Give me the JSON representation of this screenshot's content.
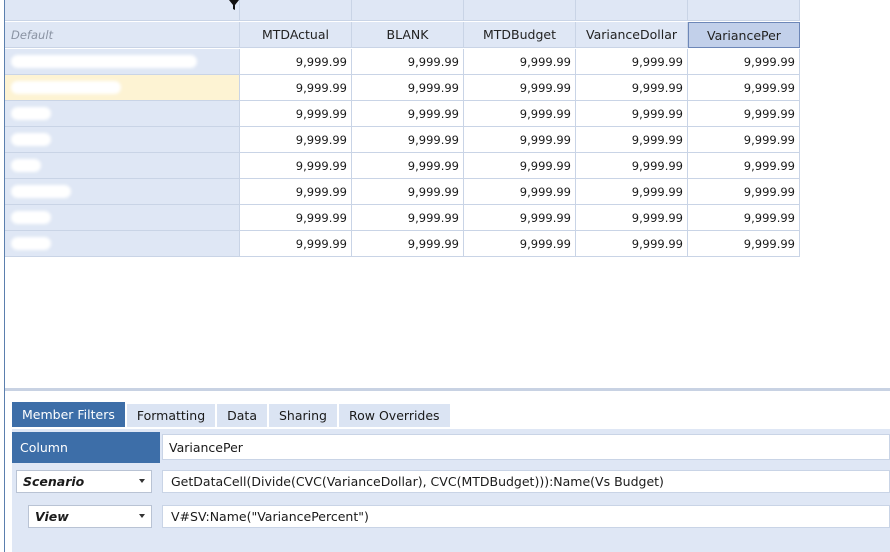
{
  "grid": {
    "row_header_label": "Default",
    "columns": [
      "MTDActual",
      "BLANK",
      "MTDBudget",
      "VarianceDollar",
      "VariancePer"
    ],
    "selected_column": "VariancePer",
    "rows": [
      [
        "9,999.99",
        "9,999.99",
        "9,999.99",
        "9,999.99",
        "9,999.99"
      ],
      [
        "9,999.99",
        "9,999.99",
        "9,999.99",
        "9,999.99",
        "9,999.99"
      ],
      [
        "9,999.99",
        "9,999.99",
        "9,999.99",
        "9,999.99",
        "9,999.99"
      ],
      [
        "9,999.99",
        "9,999.99",
        "9,999.99",
        "9,999.99",
        "9,999.99"
      ],
      [
        "9,999.99",
        "9,999.99",
        "9,999.99",
        "9,999.99",
        "9,999.99"
      ],
      [
        "9,999.99",
        "9,999.99",
        "9,999.99",
        "9,999.99",
        "9,999.99"
      ],
      [
        "9,999.99",
        "9,999.99",
        "9,999.99",
        "9,999.99",
        "9,999.99"
      ],
      [
        "9,999.99",
        "9,999.99",
        "9,999.99",
        "9,999.99",
        "9,999.99"
      ]
    ],
    "highlighted_row_index": 1,
    "icons": {
      "filter": "funnel-icon"
    }
  },
  "tabs": [
    {
      "label": "Member Filters",
      "active": true
    },
    {
      "label": "Formatting",
      "active": false
    },
    {
      "label": "Data",
      "active": false
    },
    {
      "label": "Sharing",
      "active": false
    },
    {
      "label": "Row Overrides",
      "active": false
    }
  ],
  "panel": {
    "column_label": "Column",
    "column_value": "VariancePer",
    "filters": [
      {
        "dimension": "Scenario",
        "expression": "GetDataCell(Divide(CVC(VarianceDollar), CVC(MTDBudget))):Name(Vs Budget)"
      },
      {
        "dimension": "View",
        "expression": "V#SV:Name(\"VariancePercent\")"
      }
    ]
  },
  "colors": {
    "accent": "#3d6ea8",
    "header_bg": "#dfe7f5",
    "highlight_row": "#fdf3d3"
  }
}
